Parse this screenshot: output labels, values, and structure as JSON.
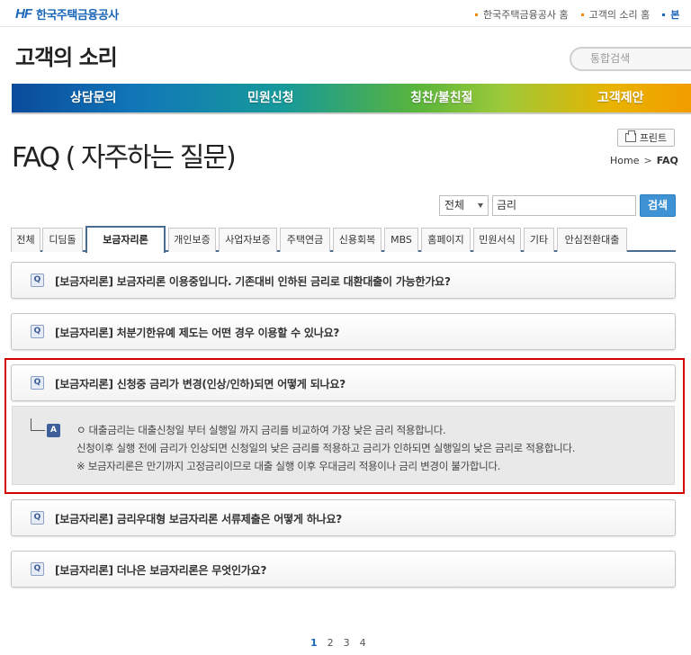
{
  "header": {
    "logo_mark": "HF",
    "logo_text": "한국주택금융공사",
    "util_links": [
      "한국주택금융공사 홈",
      "고객의 소리 홈",
      "본"
    ],
    "section_title": "고객의 소리",
    "search_placeholder": "통합검색"
  },
  "gnb": [
    "상담문의",
    "민원신청",
    "칭찬/불친절",
    "고객제안"
  ],
  "page": {
    "title": "FAQ ( 자주하는 질문)",
    "print_label": "프린트",
    "breadcrumb": [
      "Home",
      "FAQ"
    ]
  },
  "faq_search": {
    "scope": "전체",
    "query": "금리",
    "button": "검색"
  },
  "tabs": [
    "전체",
    "디딤돌",
    "보금자리론",
    "개인보증",
    "사업자보증",
    "주택연금",
    "신용회복",
    "MBS",
    "홈페이지",
    "민원서식",
    "기타",
    "안심전환대출"
  ],
  "active_tab": "보금자리론",
  "faqs": [
    {
      "q_icon": "Q",
      "text": "[보금자리론] 보금자리론 이용중입니다. 기존대비 인하된 금리로 대환대출이 가능한가요?"
    },
    {
      "q_icon": "Q",
      "text": "[보금자리론] 처분기한유예 제도는 어떤 경우 이용할 수 있나요?"
    },
    {
      "q_icon": "Q",
      "text": "[보금자리론] 신청중 금리가 변경(인상/인하)되면 어떻게 되나요?"
    },
    {
      "q_icon": "Q",
      "text": "[보금자리론] 금리우대형 보금자리론 서류제출은 어떻게 하나요?"
    },
    {
      "q_icon": "Q",
      "text": "[보금자리론] 더나은 보금자리론은 무엇인가요?"
    }
  ],
  "answer": {
    "a_icon": "A",
    "lines": [
      "ㅇ 대출금리는 대출신청일 부터 실행일 까지 금리를 비교하여 가장 낮은 금리 적용합니다.",
      "신청이후 실행 전에 금리가 인상되면 신청일의 낮은 금리를 적용하고 금리가 인하되면 실행일의 낮은 금리로 적용합니다.",
      "※ 보금자리론은 만기까지 고정금리이므로 대출 실행 이후 우대금리 적용이나 금리 변경이 불가합니다."
    ]
  },
  "pagination": [
    "1",
    "2",
    "3",
    "4"
  ],
  "current_page": "1",
  "colors": {
    "brand_blue": "#1a66b8",
    "highlight_red": "#d40000",
    "search_button": "#3f92d3"
  }
}
